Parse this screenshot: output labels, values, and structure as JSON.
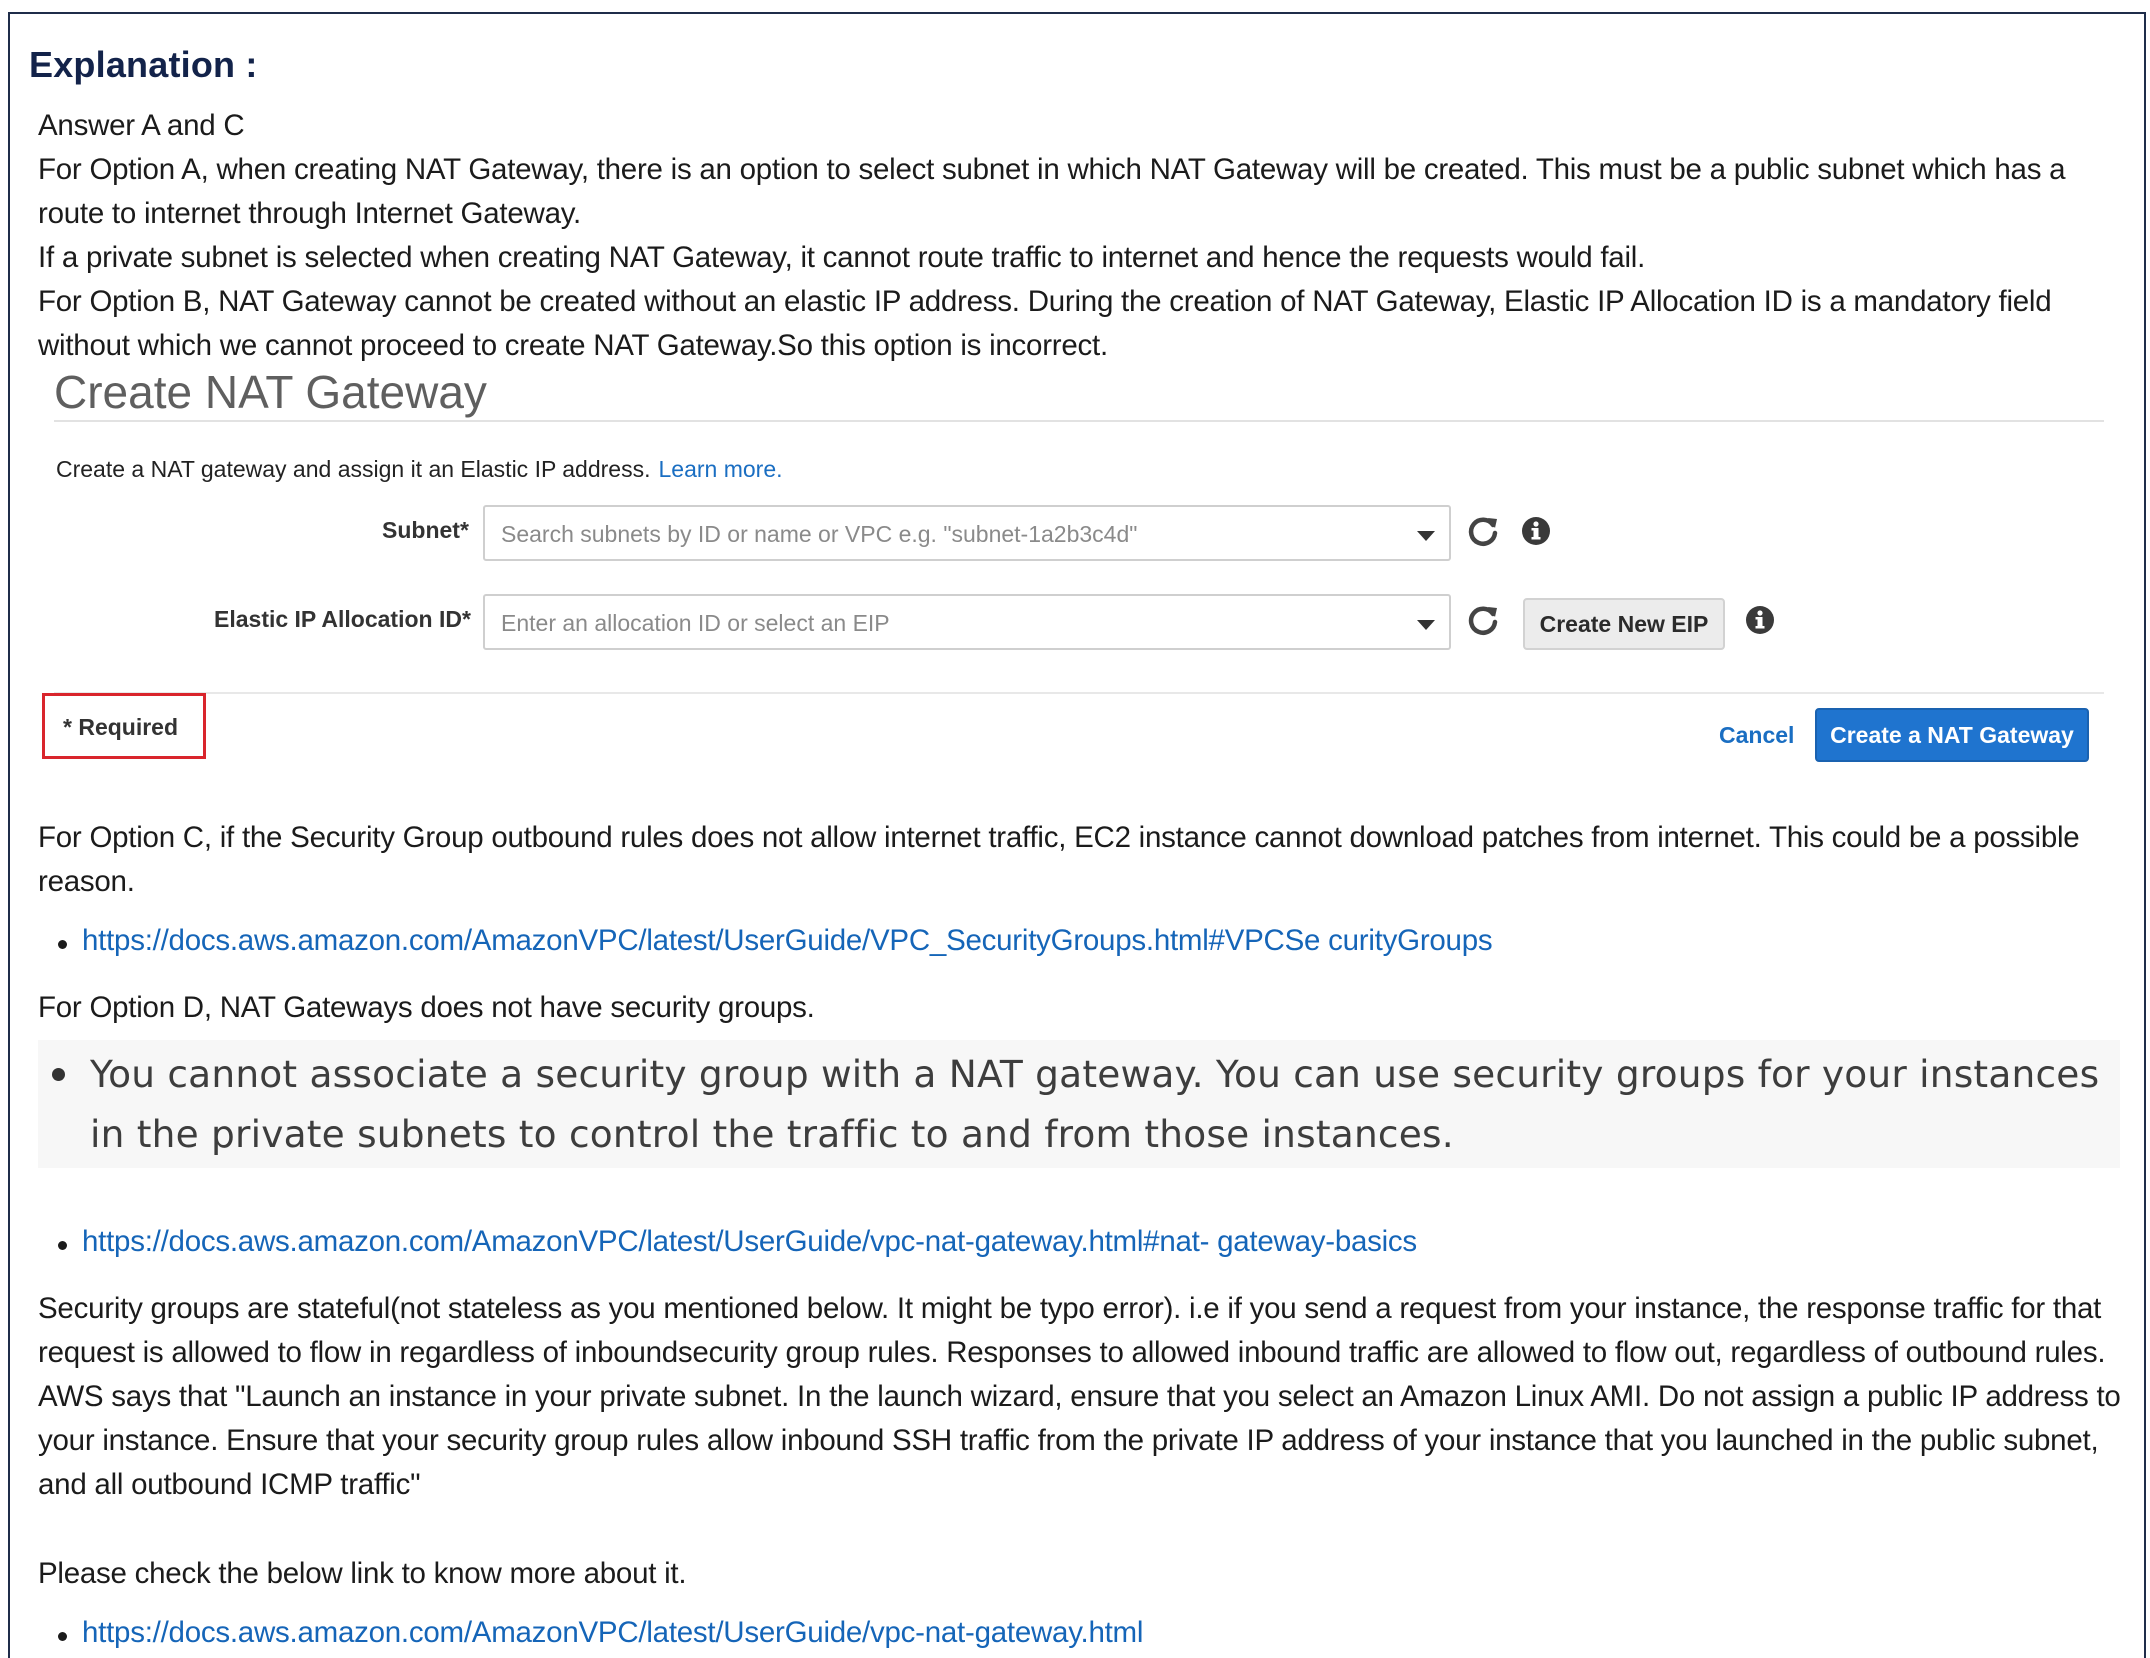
{
  "heading": "Explanation :",
  "paragraphs": {
    "p1": "Answer A and C",
    "p2": "For Option A, when creating NAT Gateway, there is an option to select subnet in which NAT Gateway will be created. This must be a public subnet which has a route to internet through Internet Gateway.",
    "p3": "If a private subnet is selected when creating NAT Gateway, it cannot route traffic to internet and hence the requests would fail.",
    "p4": "For Option B, NAT Gateway cannot be created without an elastic IP address. During the creation of NAT Gateway, Elastic IP Allocation ID is a mandatory field without which we cannot proceed to create NAT Gateway.So this option is incorrect.",
    "p5": "For Option C, if the Security Group outbound rules does not allow internet traffic, EC2 instance cannot download patches from internet. This could be a possible reason.",
    "p6": "For Option D, NAT Gateways does not have security groups.",
    "p7": "Security groups are stateful(not stateless as you mentioned below. It might be typo error). i.e if you send a request from your instance, the response traffic for that request is allowed to flow in regardless of inboundsecurity group rules. Responses to allowed inbound traffic are allowed to flow out, regardless of outbound rules. AWS says that \"Launch an instance in your private subnet. In the launch wizard, ensure that you select an Amazon Linux AMI. Do not assign a public IP address to your instance. Ensure that your security group rules allow inbound SSH traffic from the private IP address of your instance that you launched in the public subnet, and all outbound ICMP traffic\"",
    "p8": "Please check the below link to know more about it."
  },
  "nat_form": {
    "title": "Create NAT Gateway",
    "description": "Create a NAT gateway and assign it an Elastic IP address.",
    "learn_more": "Learn more.",
    "subnet_label": "Subnet*",
    "subnet_placeholder": "Search subnets by ID or name or VPC e.g. \"subnet-1a2b3c4d\"",
    "eip_label": "Elastic IP Allocation ID*",
    "eip_placeholder": "Enter an allocation ID or select an EIP",
    "create_eip_button": "Create New EIP",
    "required_note": "* Required",
    "cancel": "Cancel",
    "submit": "Create a NAT Gateway"
  },
  "links": {
    "security_groups": "https://docs.aws.amazon.com/AmazonVPC/latest/UserGuide/VPC_SecurityGroups.html#VPCSe curityGroups",
    "nat_basics": "https://docs.aws.amazon.com/AmazonVPC/latest/UserGuide/vpc-nat-gateway.html#nat- gateway-basics",
    "nat_gateway": "https://docs.aws.amazon.com/AmazonVPC/latest/UserGuide/vpc-nat-gateway.html"
  },
  "quote": "You cannot associate a security group with a NAT gateway. You can use security groups for your instances in the private subnets to control the traffic to and from those instances.",
  "colors": {
    "heading": "#13234a",
    "link": "#1565b8",
    "primary_button": "#1f74cf",
    "required_border": "#d9252c"
  }
}
